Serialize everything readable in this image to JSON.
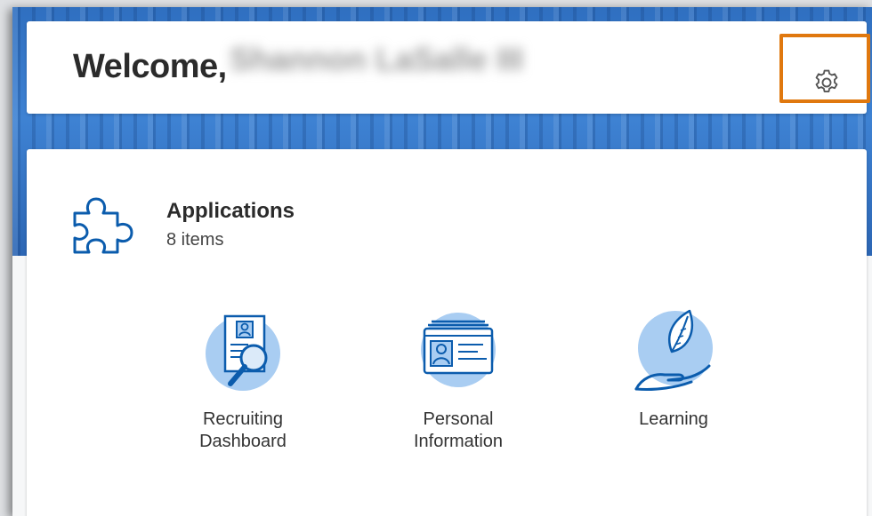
{
  "welcome": {
    "greeting": "Welcome,",
    "user_name": "Shannon LaSalle III",
    "settings_icon": "gear-icon"
  },
  "applications": {
    "title": "Applications",
    "count": "8 items",
    "icon": "puzzle-icon",
    "tiles": [
      {
        "label": "Recruiting Dashboard",
        "icon": "recruiting-dashboard-icon"
      },
      {
        "label": "Personal Information",
        "icon": "id-card-icon"
      },
      {
        "label": "Learning",
        "icon": "leaf-hand-icon"
      }
    ]
  },
  "colors": {
    "accent_blue": "#0b5cad",
    "light_blue": "#a9cdf2",
    "highlight_orange": "#e0780e",
    "banner_blue": "#3e82d3"
  }
}
